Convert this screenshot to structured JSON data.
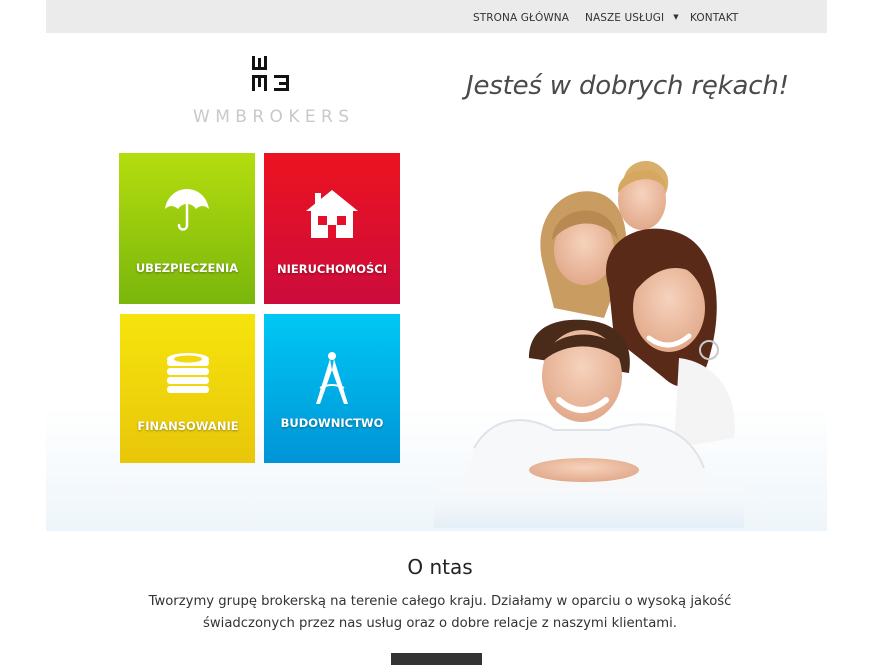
{
  "nav": {
    "home": "STRONA GŁÓWNA",
    "services": "NASZE USŁUGI",
    "services_caret": "▼",
    "contact": "KONTAKT"
  },
  "logo": {
    "text": "WMBROKERS"
  },
  "tagline": "Jesteś w dobrych rękach!",
  "tiles": [
    {
      "label": "UBEZPIECZENIA",
      "icon": "umbrella-icon",
      "color": "#9bcb0d"
    },
    {
      "label": "NIERUCHOMOŚCI",
      "icon": "house-icon",
      "color": "#e5102b"
    },
    {
      "label": "FINANSOWANIE",
      "icon": "coins-icon",
      "color": "#f2d80c"
    },
    {
      "label": "BUDOWNICTWO",
      "icon": "compass-icon",
      "color": "#00aee6"
    }
  ],
  "about": {
    "title": "O ntas",
    "text_line1": "Tworzymy grupę brokerską na terenie całego kraju. Działamy w oparciu o wysoką jakość",
    "text_line2": "świadczonych przez nas usług oraz o dobre relacje z naszymi klientami."
  }
}
